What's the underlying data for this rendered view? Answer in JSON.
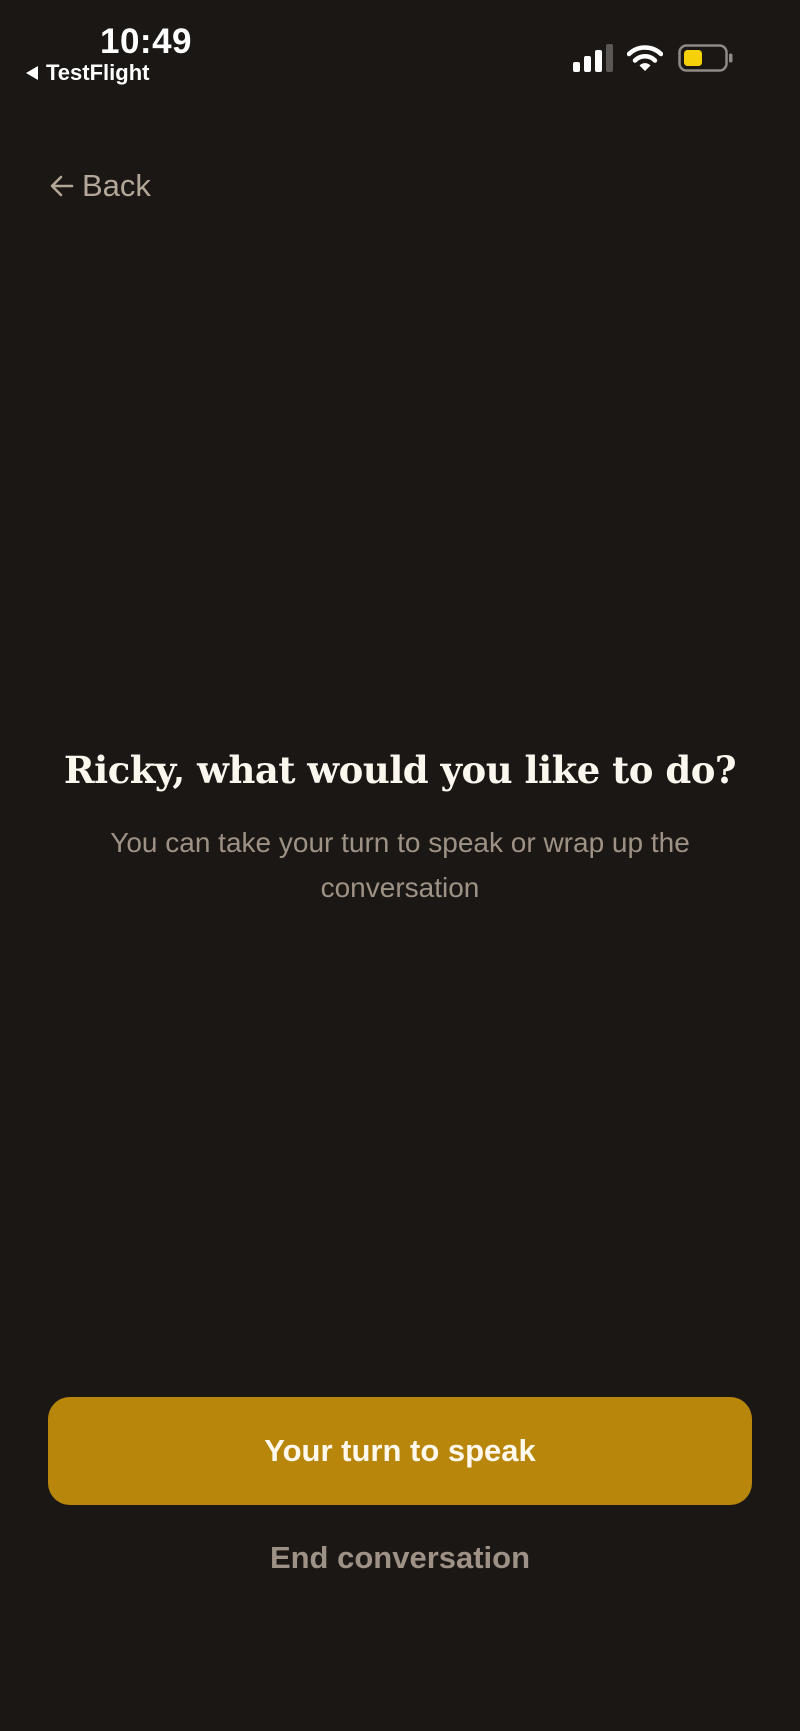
{
  "status_bar": {
    "time": "10:49",
    "return_app": "TestFlight",
    "battery_color": "#f5d10a"
  },
  "navigation": {
    "back_label": "Back"
  },
  "prompt": {
    "title": "Ricky, what would you like to do?",
    "subtitle": "You can take your turn to speak or wrap up the conversation"
  },
  "actions": {
    "primary_label": "Your turn to speak",
    "secondary_label": "End conversation",
    "accent_color": "#b8860b"
  }
}
